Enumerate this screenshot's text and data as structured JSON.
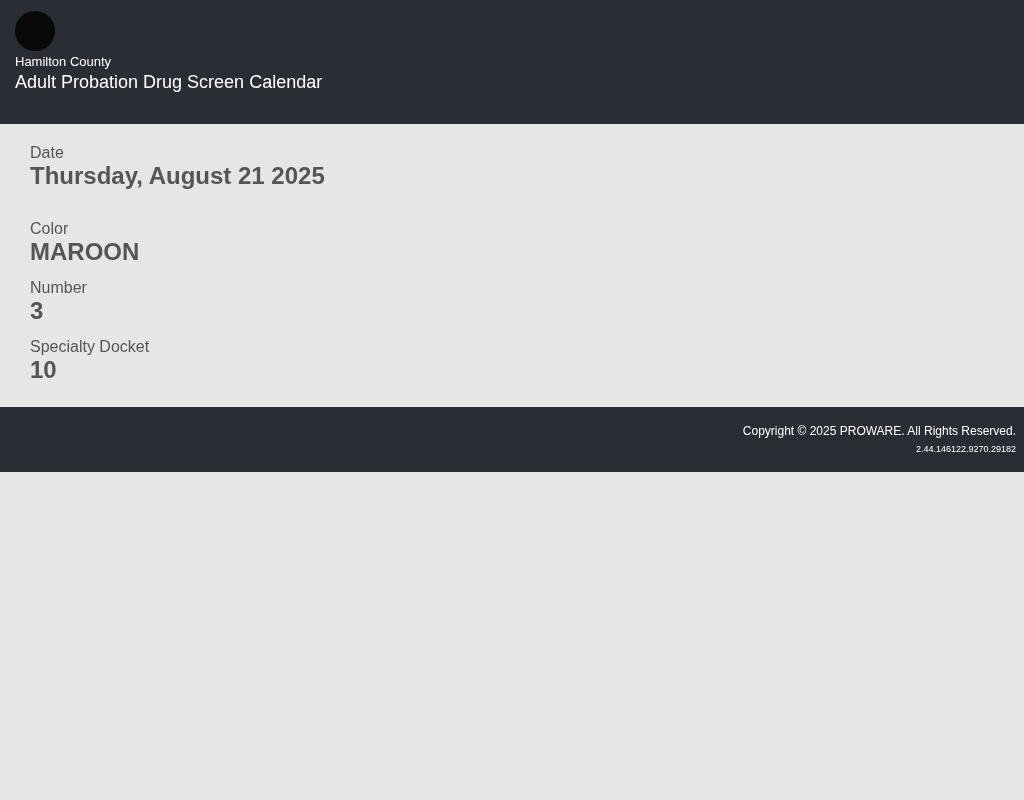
{
  "header": {
    "subtitle": "Hamilton County",
    "title": "Adult Probation Drug Screen Calendar"
  },
  "fields": [
    {
      "label": "Date",
      "value": "Thursday, August 21 2025"
    },
    {
      "label": "Color",
      "value": "MAROON"
    },
    {
      "label": "Number",
      "value": "3"
    },
    {
      "label": "Specialty Docket",
      "value": "10"
    }
  ],
  "footer": {
    "copyright": "Copyright © 2025 PROWARE. All Rights Reserved.",
    "version": "2.44.146122.9270.29182"
  }
}
